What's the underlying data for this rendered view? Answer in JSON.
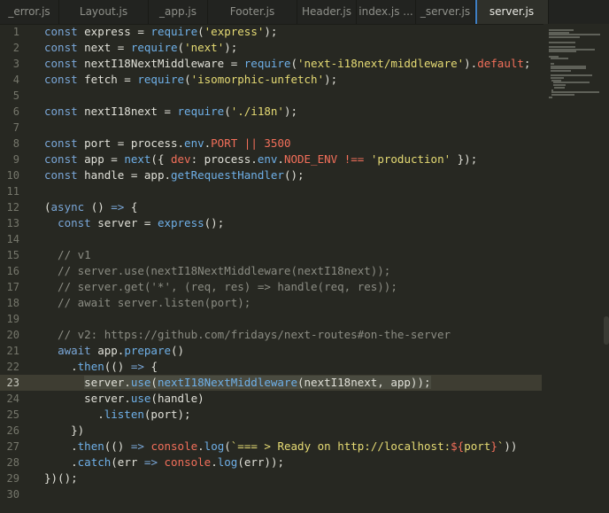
{
  "tabs": [
    {
      "label": "_error.js",
      "active": false
    },
    {
      "label": "Layout.js",
      "active": false
    },
    {
      "label": "_app.js",
      "active": false
    },
    {
      "label": "Footer.js",
      "active": false
    },
    {
      "label": "Header.js",
      "active": false
    },
    {
      "label": "index.js ...",
      "active": false
    },
    {
      "label": "_server.js",
      "active": false
    },
    {
      "label": "server.js",
      "active": true
    }
  ],
  "current_line": 23,
  "lines": [
    {
      "n": "1",
      "t": [
        [
          "k",
          "const "
        ],
        [
          "p",
          "express = "
        ],
        [
          "f",
          "require"
        ],
        [
          "p",
          "("
        ],
        [
          "s",
          "'express'"
        ],
        [
          "p",
          ");"
        ]
      ]
    },
    {
      "n": "2",
      "t": [
        [
          "k",
          "const "
        ],
        [
          "p",
          "next = "
        ],
        [
          "f",
          "require"
        ],
        [
          "p",
          "("
        ],
        [
          "s",
          "'next'"
        ],
        [
          "p",
          ");"
        ]
      ]
    },
    {
      "n": "3",
      "t": [
        [
          "k",
          "const "
        ],
        [
          "p",
          "nextI18NextMiddleware = "
        ],
        [
          "f",
          "require"
        ],
        [
          "p",
          "("
        ],
        [
          "s",
          "'next-i18next/middleware'"
        ],
        [
          "p",
          ")."
        ],
        [
          "n",
          "default"
        ],
        [
          "p",
          ";"
        ]
      ]
    },
    {
      "n": "4",
      "t": [
        [
          "k",
          "const "
        ],
        [
          "p",
          "fetch = "
        ],
        [
          "f",
          "require"
        ],
        [
          "p",
          "("
        ],
        [
          "s",
          "'isomorphic-unfetch'"
        ],
        [
          "p",
          ");"
        ]
      ]
    },
    {
      "n": "5",
      "t": []
    },
    {
      "n": "6",
      "t": [
        [
          "k",
          "const "
        ],
        [
          "p",
          "nextI18next = "
        ],
        [
          "f",
          "require"
        ],
        [
          "p",
          "("
        ],
        [
          "s",
          "'./i18n'"
        ],
        [
          "p",
          ");"
        ]
      ]
    },
    {
      "n": "7",
      "t": []
    },
    {
      "n": "8",
      "t": [
        [
          "k",
          "const "
        ],
        [
          "p",
          "port = process."
        ],
        [
          "f",
          "env"
        ],
        [
          "p",
          "."
        ],
        [
          "n",
          "PORT"
        ],
        [
          "p",
          " "
        ],
        [
          "g",
          "||"
        ],
        [
          "p",
          " "
        ],
        [
          "n",
          "3500"
        ]
      ]
    },
    {
      "n": "9",
      "t": [
        [
          "k",
          "const "
        ],
        [
          "p",
          "app = "
        ],
        [
          "f",
          "next"
        ],
        [
          "p",
          "({ "
        ],
        [
          "n",
          "dev"
        ],
        [
          "p",
          ": process."
        ],
        [
          "f",
          "env"
        ],
        [
          "p",
          "."
        ],
        [
          "n",
          "NODE_ENV"
        ],
        [
          "p",
          " "
        ],
        [
          "g",
          "!=="
        ],
        [
          "p",
          " "
        ],
        [
          "s",
          "'production'"
        ],
        [
          "p",
          " });"
        ]
      ]
    },
    {
      "n": "10",
      "t": [
        [
          "k",
          "const "
        ],
        [
          "p",
          "handle = app."
        ],
        [
          "f",
          "getRequestHandler"
        ],
        [
          "p",
          "();"
        ]
      ]
    },
    {
      "n": "11",
      "t": []
    },
    {
      "n": "12",
      "t": [
        [
          "p",
          "("
        ],
        [
          "k",
          "async"
        ],
        [
          "p",
          " () "
        ],
        [
          "k",
          "=>"
        ],
        [
          "p",
          " {"
        ]
      ]
    },
    {
      "n": "13",
      "t": [
        [
          "p",
          "  "
        ],
        [
          "k",
          "const "
        ],
        [
          "p",
          "server = "
        ],
        [
          "f",
          "express"
        ],
        [
          "p",
          "();"
        ]
      ]
    },
    {
      "n": "14",
      "t": []
    },
    {
      "n": "15",
      "t": [
        [
          "c",
          "  // v1"
        ]
      ]
    },
    {
      "n": "16",
      "t": [
        [
          "c",
          "  // server.use(nextI18NextMiddleware(nextI18next));"
        ]
      ]
    },
    {
      "n": "17",
      "t": [
        [
          "c",
          "  // server.get('*', (req, res) => handle(req, res));"
        ]
      ]
    },
    {
      "n": "18",
      "t": [
        [
          "c",
          "  // await server.listen(port);"
        ]
      ]
    },
    {
      "n": "19",
      "t": []
    },
    {
      "n": "20",
      "t": [
        [
          "c",
          "  // v2: https://github.com/fridays/next-routes#on-the-server"
        ]
      ]
    },
    {
      "n": "21",
      "t": [
        [
          "p",
          "  "
        ],
        [
          "k",
          "await "
        ],
        [
          "p",
          "app."
        ],
        [
          "f",
          "prepare"
        ],
        [
          "p",
          "()"
        ]
      ]
    },
    {
      "n": "22",
      "t": [
        [
          "p",
          "    ."
        ],
        [
          "f",
          "then"
        ],
        [
          "p",
          "(() "
        ],
        [
          "k",
          "=>"
        ],
        [
          "p",
          " {"
        ]
      ]
    },
    {
      "n": "23",
      "t": [
        [
          "p",
          "      "
        ],
        [
          "sel",
          "server."
        ],
        [
          "self",
          "use"
        ],
        [
          "sel",
          "("
        ],
        [
          "self",
          "nextI18NextMiddleware"
        ],
        [
          "sel",
          "(nextI18next, app));"
        ]
      ]
    },
    {
      "n": "24",
      "t": [
        [
          "p",
          "      server."
        ],
        [
          "f",
          "use"
        ],
        [
          "p",
          "(handle)"
        ]
      ]
    },
    {
      "n": "25",
      "t": [
        [
          "p",
          "        ."
        ],
        [
          "f",
          "listen"
        ],
        [
          "p",
          "(port);"
        ]
      ]
    },
    {
      "n": "26",
      "t": [
        [
          "p",
          "    })"
        ]
      ]
    },
    {
      "n": "27",
      "t": [
        [
          "p",
          "    ."
        ],
        [
          "f",
          "then"
        ],
        [
          "p",
          "(() "
        ],
        [
          "k",
          "=>"
        ],
        [
          "p",
          " "
        ],
        [
          "n",
          "console"
        ],
        [
          "p",
          "."
        ],
        [
          "f",
          "log"
        ],
        [
          "p",
          "("
        ],
        [
          "s",
          "`=== > Ready on http://localhost:"
        ],
        [
          "n",
          "${"
        ],
        [
          "s",
          "port"
        ],
        [
          "n",
          "}"
        ],
        [
          "s",
          "`"
        ],
        [
          "p",
          "))"
        ]
      ]
    },
    {
      "n": "28",
      "t": [
        [
          "p",
          "    ."
        ],
        [
          "f",
          "catch"
        ],
        [
          "p",
          "(err "
        ],
        [
          "k",
          "=>"
        ],
        [
          "p",
          " "
        ],
        [
          "n",
          "console"
        ],
        [
          "p",
          "."
        ],
        [
          "f",
          "log"
        ],
        [
          "p",
          "(err));"
        ]
      ]
    },
    {
      "n": "29",
      "t": [
        [
          "p",
          "})();"
        ]
      ]
    },
    {
      "n": "30",
      "t": []
    }
  ],
  "colors": {
    "background": "#272822",
    "keyword": "#7aa7d8",
    "string": "#e6db74",
    "comment": "#8b8c83",
    "number_const": "#f26f5a",
    "function": "#6fb0e8",
    "active_tab_accent": "#3f7fc4"
  }
}
